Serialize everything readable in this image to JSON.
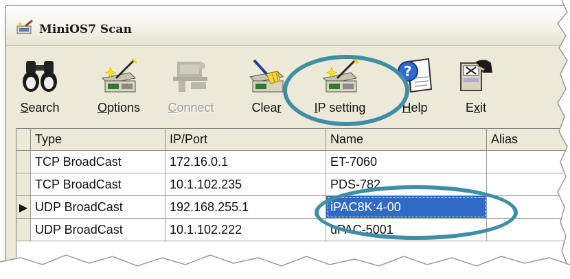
{
  "window": {
    "title": "MiniOS7 Scan",
    "app_icon": "minios7-scan-icon"
  },
  "toolbar": {
    "buttons": [
      {
        "label": "Search",
        "mnemonic": "S",
        "rest": "earch",
        "icon": "binoculars-icon",
        "enabled": true
      },
      {
        "label": "Options",
        "mnemonic": "O",
        "rest": "ptions",
        "icon": "module-wand-icon",
        "enabled": true
      },
      {
        "label": "Connect",
        "mnemonic": "C",
        "rest": "onnect",
        "icon": "connect-icon",
        "enabled": false
      },
      {
        "label": "Clear",
        "pre": "Clea",
        "mnemonic": "r",
        "icon": "broom-icon",
        "enabled": true
      },
      {
        "label": "IP setting",
        "mnemonic": "I",
        "rest": "P setting",
        "icon": "module-wand-icon",
        "enabled": true
      },
      {
        "label": "Help",
        "mnemonic": "H",
        "rest": "elp",
        "icon": "help-book-icon",
        "enabled": true
      },
      {
        "label": "Exit",
        "pre": "E",
        "mnemonic": "x",
        "post": "it",
        "icon": "exit-icon",
        "enabled": true
      }
    ]
  },
  "grid": {
    "columns": [
      "Type",
      "IP/Port",
      "Name",
      "Alias"
    ],
    "rows": [
      {
        "type": "TCP BroadCast",
        "ip": "172.16.0.1",
        "name": "ET-7060",
        "alias": "",
        "current": false
      },
      {
        "type": "TCP BroadCast",
        "ip": "10.1.102.235",
        "name": "PDS-782",
        "alias": "",
        "current": false
      },
      {
        "type": "UDP BroadCast",
        "ip": "192.168.255.1",
        "name": "iPAC8K:4-00",
        "alias": "",
        "current": true
      },
      {
        "type": "UDP BroadCast",
        "ip": "10.1.102.222",
        "name": "uPAC-5001",
        "alias": "",
        "current": false
      }
    ],
    "current_row_marker": "▶"
  },
  "colors": {
    "highlight_circle": "#3e8fa6",
    "selection": "#316ac5",
    "window_bg": "#ece9d8"
  }
}
